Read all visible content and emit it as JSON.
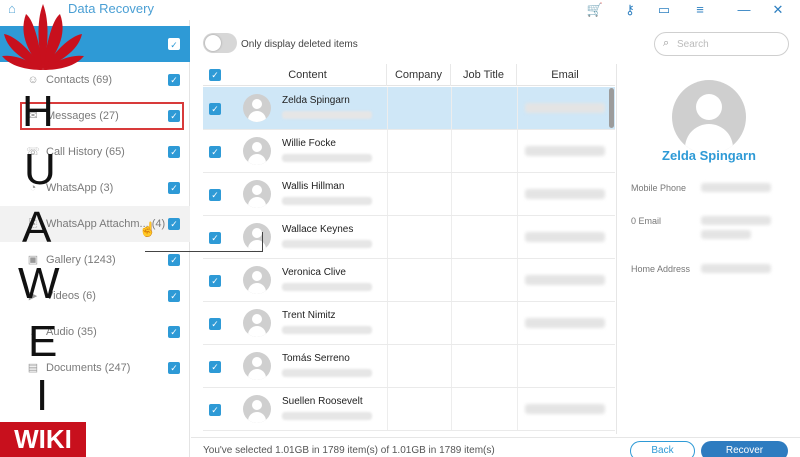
{
  "app": {
    "title": "Data Recovery",
    "icons": [
      "home-icon",
      "cart-icon",
      "key-icon",
      "feedback-icon",
      "menu-icon",
      "minimize-icon",
      "close-icon"
    ]
  },
  "sidebar": {
    "items": [
      {
        "label": "Contacts (69)",
        "icon": "contacts-icon"
      },
      {
        "label": "Messages (27)",
        "icon": "messages-icon"
      },
      {
        "label": "Call History (65)",
        "icon": "call-icon"
      },
      {
        "label": "WhatsApp (3)",
        "icon": "whatsapp-icon"
      },
      {
        "label": "WhatsApp Attachm... (4)",
        "icon": "attachment-icon"
      },
      {
        "label": "Gallery (1243)",
        "icon": "gallery-icon"
      },
      {
        "label": "Videos (6)",
        "icon": "video-icon"
      },
      {
        "label": "Audio (35)",
        "icon": "audio-icon"
      },
      {
        "label": "Documents (247)",
        "icon": "document-icon"
      }
    ]
  },
  "toolbar": {
    "toggle_label": "Only display deleted items",
    "search_placeholder": "Search"
  },
  "table": {
    "columns": [
      "Content",
      "Company",
      "Job Title",
      "Email"
    ],
    "rows": [
      {
        "name": "Zelda Spingarn",
        "selected": true
      },
      {
        "name": "Willie Focke",
        "selected": false
      },
      {
        "name": "Wallis Hillman",
        "selected": false
      },
      {
        "name": "Wallace Keynes",
        "selected": false
      },
      {
        "name": "Veronica Clive",
        "selected": false
      },
      {
        "name": "Trent Nimitz",
        "selected": false
      },
      {
        "name": "Tomás Serreno",
        "selected": false
      },
      {
        "name": "Suellen Roosevelt",
        "selected": false
      }
    ]
  },
  "detail": {
    "name": "Zelda Spingarn",
    "fields": [
      "Mobile Phone",
      "0 Email",
      "Home Address"
    ]
  },
  "footer": {
    "status": "You've selected 1.01GB in 1789 item(s) of 1.01GB in 1789 item(s)",
    "back_label": "Back",
    "recover_label": "Recover"
  },
  "watermark": {
    "letters": [
      "H",
      "U",
      "A",
      "W",
      "E",
      "I"
    ],
    "wiki": "WIKI"
  },
  "colors": {
    "accent": "#2e9ad6",
    "selected_row": "#cfe7f7",
    "highlight_box": "#d83a3a",
    "recover_button": "#2e7cc0"
  }
}
